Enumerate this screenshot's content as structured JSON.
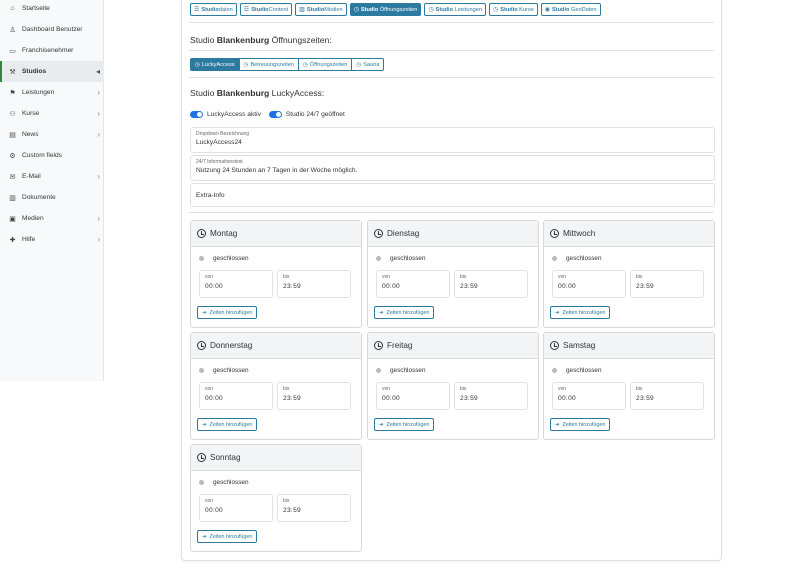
{
  "sidebar": {
    "items": [
      {
        "label": "Startseite",
        "icon": "home-icon",
        "glyph": "⌂",
        "chevron": false,
        "active": false
      },
      {
        "label": "Dashboard Benutzer",
        "icon": "user-icon",
        "glyph": "♙",
        "chevron": false,
        "active": false
      },
      {
        "label": "Franchisenehmer",
        "icon": "briefcase-icon",
        "glyph": "▭",
        "chevron": false,
        "active": false
      },
      {
        "label": "Studios",
        "icon": "dumbbell-icon",
        "glyph": "⚒",
        "chevron": true,
        "active": true
      },
      {
        "label": "Leistungen",
        "icon": "service-icon",
        "glyph": "⚑",
        "chevron": true,
        "active": false
      },
      {
        "label": "Kurse",
        "icon": "people-icon",
        "glyph": "⚇",
        "chevron": true,
        "active": false
      },
      {
        "label": "News",
        "icon": "news-icon",
        "glyph": "▤",
        "chevron": true,
        "active": false
      },
      {
        "label": "Custom fields",
        "icon": "gear-icon",
        "glyph": "⚙",
        "chevron": false,
        "active": false
      },
      {
        "label": "E-Mail",
        "icon": "mail-icon",
        "glyph": "✉",
        "chevron": true,
        "active": false
      },
      {
        "label": "Dokumente",
        "icon": "document-icon",
        "glyph": "▥",
        "chevron": false,
        "active": false
      },
      {
        "label": "Medien",
        "icon": "media-icon",
        "glyph": "▣",
        "chevron": true,
        "active": false
      },
      {
        "label": "Hilfe",
        "icon": "help-icon",
        "glyph": "✚",
        "chevron": true,
        "active": false
      }
    ]
  },
  "top_tabs": [
    {
      "bold": "Studio",
      "rest": "daten",
      "icon": "list-icon",
      "glyph": "☰",
      "active": false
    },
    {
      "bold": "Studio",
      "rest": "Content",
      "icon": "content-icon",
      "glyph": "☰",
      "active": false
    },
    {
      "bold": "Studio",
      "rest": "Medien",
      "icon": "image-icon",
      "glyph": "▨",
      "active": false
    },
    {
      "bold": "Studio",
      "rest": " Öffnungszeiten",
      "icon": "clock-icon",
      "glyph": "◷",
      "active": true
    },
    {
      "bold": "Studio",
      "rest": " Leistungen",
      "icon": "clock-icon",
      "glyph": "◷",
      "active": false
    },
    {
      "bold": "Studio",
      "rest": " Kurse",
      "icon": "clock-icon",
      "glyph": "◷",
      "active": false
    },
    {
      "bold": "Studio",
      "rest": " GeoDaten",
      "icon": "map-pin-icon",
      "glyph": "◉",
      "active": false
    }
  ],
  "heading1": {
    "prefix": "Studio ",
    "name": "Blankenburg",
    "suffix": " Öffnungszeiten:"
  },
  "sub_tabs": [
    {
      "label": "LuckyAccess",
      "active": true
    },
    {
      "label": "Betreuungszeiten",
      "active": false
    },
    {
      "label": "Öffnungszeiten",
      "active": false
    },
    {
      "label": "Sauna",
      "active": false
    }
  ],
  "heading2": {
    "prefix": "Studio ",
    "name": "Blankenburg",
    "suffix": " LuckyAccess:"
  },
  "toggles": {
    "access_label": "LuckyAccess aktiv",
    "open_label": "Studio 24/7 geöffnet"
  },
  "fields": {
    "dropdown": {
      "label": "Dropdown Bezeichnung",
      "value": "LuckyAccess24"
    },
    "info": {
      "label": "24/7 Informationstext",
      "value": "Nutzung 24 Stunden an 7 Tagen in der Woche möglich."
    },
    "extra": {
      "value": "Extra-Info"
    }
  },
  "days": [
    {
      "name": "Montag",
      "closed": "geschlossen",
      "from_label": "von",
      "from": "00:00",
      "to_label": "bis",
      "to": "23:59",
      "add": "Zeiten hinzufügen"
    },
    {
      "name": "Dienstag",
      "closed": "geschlossen",
      "from_label": "von",
      "from": "00:00",
      "to_label": "bis",
      "to": "23:59",
      "add": "Zeiten hinzufügen"
    },
    {
      "name": "Mittwoch",
      "closed": "geschlossen",
      "from_label": "von",
      "from": "00:00",
      "to_label": "bis",
      "to": "23:59",
      "add": "Zeiten hinzufügen"
    },
    {
      "name": "Donnerstag",
      "closed": "geschlossen",
      "from_label": "von",
      "from": "00:00",
      "to_label": "bis",
      "to": "23:59",
      "add": "Zeiten hinzufügen"
    },
    {
      "name": "Freitag",
      "closed": "geschlossen",
      "from_label": "von",
      "from": "00:00",
      "to_label": "bis",
      "to": "23:59",
      "add": "Zeiten hinzufügen"
    },
    {
      "name": "Samstag",
      "closed": "geschlossen",
      "from_label": "von",
      "from": "00:00",
      "to_label": "bis",
      "to": "23:59",
      "add": "Zeiten hinzufügen"
    },
    {
      "name": "Sonntag",
      "closed": "geschlossen",
      "from_label": "von",
      "from": "00:00",
      "to_label": "bis",
      "to": "23:59",
      "add": "Zeiten hinzufügen"
    }
  ],
  "colors": {
    "accent": "#2c7aa0",
    "toggle": "#1a73e8",
    "active_marker": "#2a8a3a"
  }
}
